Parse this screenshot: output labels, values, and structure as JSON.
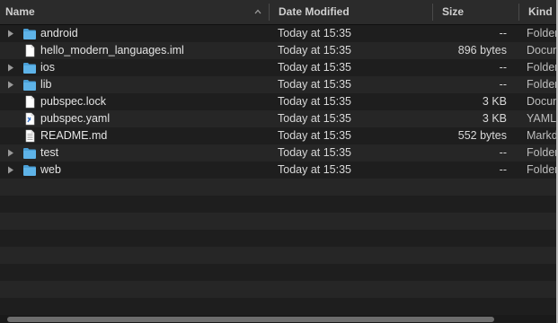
{
  "columns": {
    "name": "Name",
    "date_modified": "Date Modified",
    "size": "Size",
    "kind": "Kind"
  },
  "files": [
    {
      "name": "android",
      "date": "Today at 15:35",
      "size": "--",
      "kind": "Folder",
      "type": "folder"
    },
    {
      "name": "hello_modern_languages.iml",
      "date": "Today at 15:35",
      "size": "896 bytes",
      "kind": "Document",
      "type": "doc"
    },
    {
      "name": "ios",
      "date": "Today at 15:35",
      "size": "--",
      "kind": "Folder",
      "type": "folder"
    },
    {
      "name": "lib",
      "date": "Today at 15:35",
      "size": "--",
      "kind": "Folder",
      "type": "folder"
    },
    {
      "name": "pubspec.lock",
      "date": "Today at 15:35",
      "size": "3 KB",
      "kind": "Document",
      "type": "doc"
    },
    {
      "name": "pubspec.yaml",
      "date": "Today at 15:35",
      "size": "3 KB",
      "kind": "YAML",
      "type": "yaml"
    },
    {
      "name": "README.md",
      "date": "Today at 15:35",
      "size": "552 bytes",
      "kind": "Markdown",
      "type": "markdown"
    },
    {
      "name": "test",
      "date": "Today at 15:35",
      "size": "--",
      "kind": "Folder",
      "type": "folder"
    },
    {
      "name": "web",
      "date": "Today at 15:35",
      "size": "--",
      "kind": "Folder",
      "type": "folder"
    }
  ],
  "empty_row_count": 8,
  "colors": {
    "folder": "#5eb3e8",
    "background": "#1e1e1e",
    "alt_row": "#262626"
  }
}
